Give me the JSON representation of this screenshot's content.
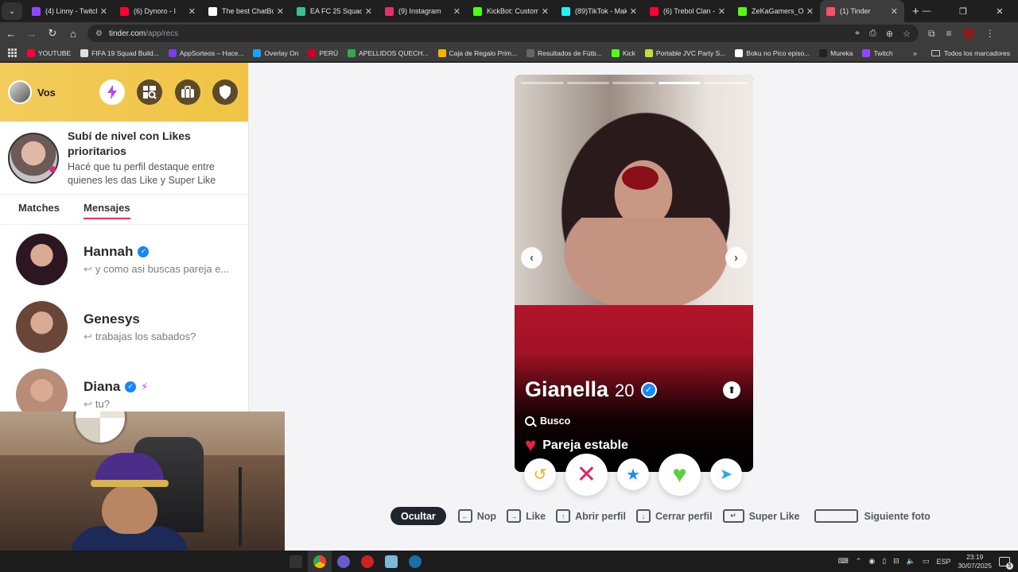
{
  "browser": {
    "tabs": [
      {
        "title": "(4) Linny - Twitch",
        "color": "#9146ff"
      },
      {
        "title": "(6) Dynoro - I",
        "color": "#ff0033"
      },
      {
        "title": "The best ChatBot",
        "color": "#ffffff"
      },
      {
        "title": "EA FC 25 Squad B",
        "color": "#3fbf8f"
      },
      {
        "title": "(9) Instagram",
        "color": "#e1306c"
      },
      {
        "title": "KickBot: Customiz",
        "color": "#53fc18"
      },
      {
        "title": "(89)TikTok - Make",
        "color": "#25f4ee"
      },
      {
        "title": "(6) Trebol Clan - A",
        "color": "#ff0033"
      },
      {
        "title": "ZeKaGamers_Ofic",
        "color": "#53fc18"
      },
      {
        "title": "(1) Tinder",
        "color": "#fd5068"
      }
    ],
    "active_tab": 9,
    "url_host": "tinder.com",
    "url_path": "/app/recs",
    "bookmarks": [
      {
        "label": "YOUTUBE",
        "color": "#ff0033"
      },
      {
        "label": "FIFA 19 Squad Build...",
        "color": "#e0e0e0"
      },
      {
        "label": "AppSorteos – Hace...",
        "color": "#7b3fe4"
      },
      {
        "label": "Overlay On",
        "color": "#1da1f2"
      },
      {
        "label": "PERÚ",
        "color": "#d6001c"
      },
      {
        "label": "APELLIDOS QUECH...",
        "color": "#34a853"
      },
      {
        "label": "Caja de Regalo Prim...",
        "color": "#f4b400"
      },
      {
        "label": "Resultados de Fútb...",
        "color": "#666666"
      },
      {
        "label": "Kick",
        "color": "#53fc18"
      },
      {
        "label": "Portable JVC Party S...",
        "color": "#c6e03a"
      },
      {
        "label": "Boku no Pico episo...",
        "color": "#ffffff"
      },
      {
        "label": "Mureka",
        "color": "#222222"
      },
      {
        "label": "Twitch",
        "color": "#9146ff"
      }
    ],
    "all_bookmarks": "Todos los marcadores"
  },
  "sidebar": {
    "user_label": "Vos",
    "promo_title": "Subí de nivel con Likes prioritarios",
    "promo_subtitle": "Hacé que tu perfil destaque entre quienes les das Like y Super Like",
    "tabs": [
      "Matches",
      "Mensajes"
    ],
    "active_tab": 1,
    "messages": [
      {
        "name": "Hannah",
        "text": "y como asi buscas pareja e...",
        "verified": true,
        "boost": false,
        "avatar": "#2b1622"
      },
      {
        "name": "Genesys",
        "text": "trabajas los sabados?",
        "verified": false,
        "boost": false,
        "avatar": "#6a4638"
      },
      {
        "name": "Diana",
        "text": "tu?",
        "verified": true,
        "boost": true,
        "avatar": "#b88c76"
      }
    ]
  },
  "card": {
    "name": "Gianella",
    "age": "20",
    "verified": true,
    "busco_label": "Busco",
    "relationship_goal": "Pareja estable",
    "photo_count": 5,
    "current_photo": 3
  },
  "shortcuts": {
    "hide_label": "Ocultar",
    "items": [
      {
        "key": "←",
        "label": "Nop"
      },
      {
        "key": "→",
        "label": "Like"
      },
      {
        "key": "↑",
        "label": "Abrir perfil"
      },
      {
        "key": "↓",
        "label": "Cerrar perfil"
      },
      {
        "key": "↵",
        "label": "Super Like"
      },
      {
        "key": "",
        "label": "Siguiente foto"
      }
    ]
  },
  "taskbar": {
    "lang": "ESP",
    "time": "23:19",
    "date": "30/07/2025",
    "notifications": "5"
  },
  "colors": {
    "tinder_pink": "#fd267a",
    "nope": "#e4206c",
    "like": "#58d23e",
    "super_like": "#1790f0",
    "rewind": "#f3b01a",
    "verified": "#1786f8"
  }
}
